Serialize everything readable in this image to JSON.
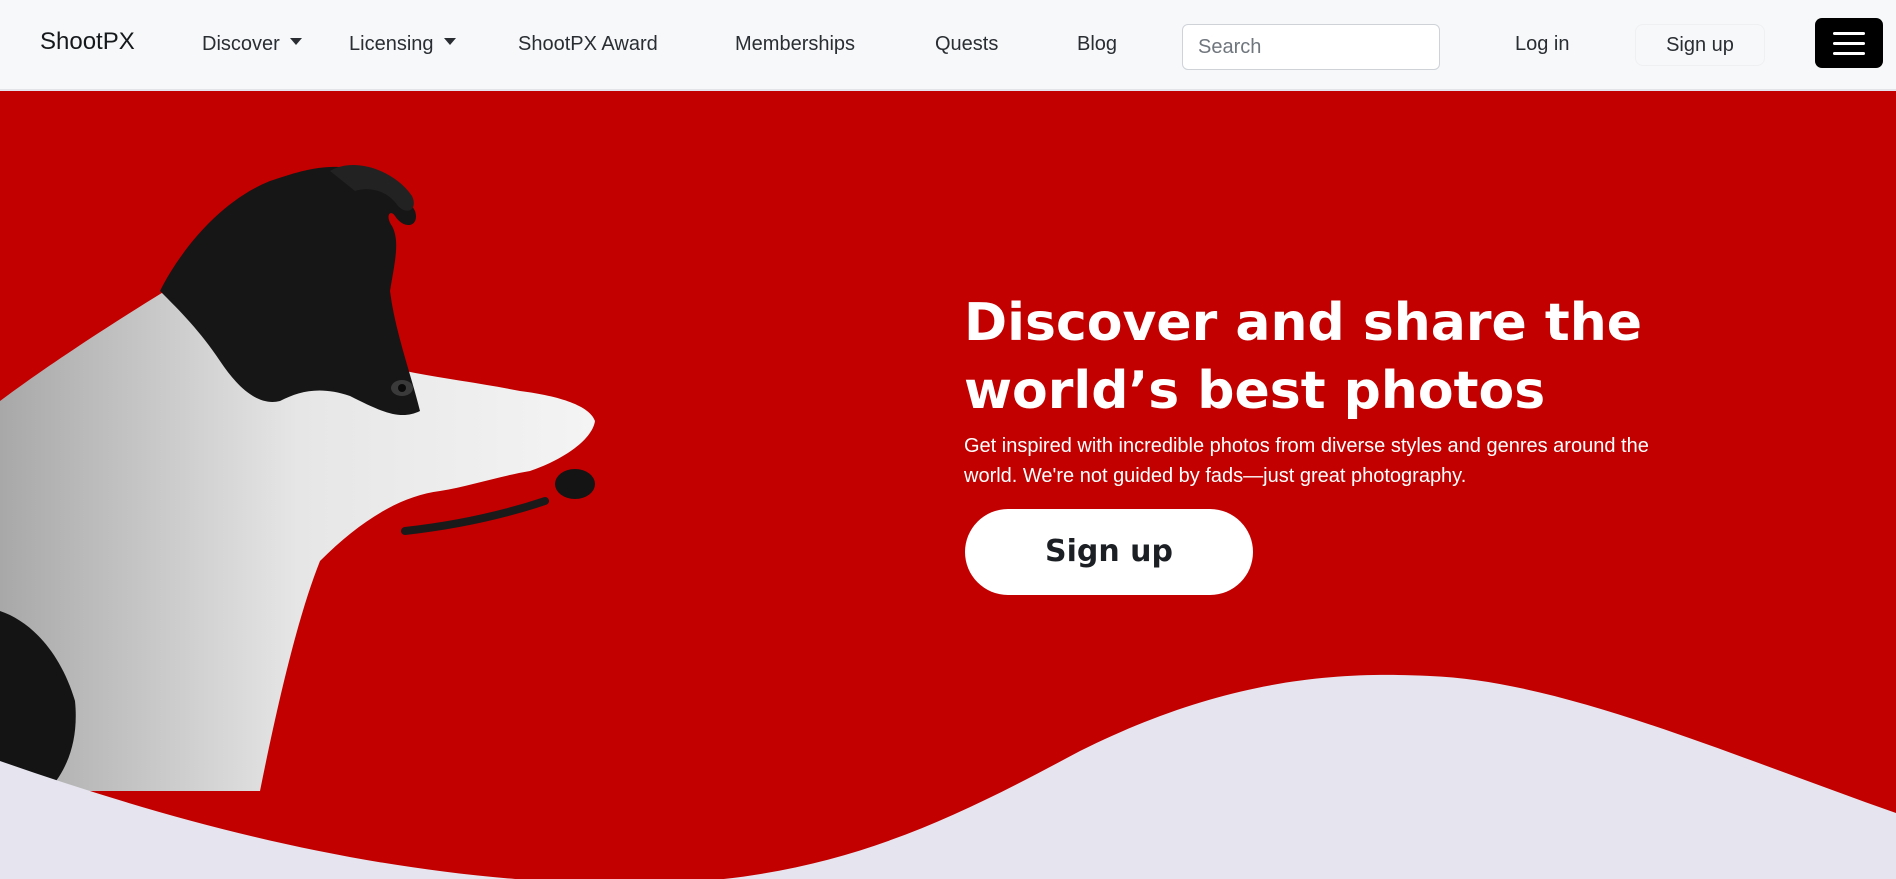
{
  "nav": {
    "brand": "ShootPX",
    "discover": "Discover",
    "licensing": "Licensing",
    "award": "ShootPX Award",
    "memberships": "Memberships",
    "quests": "Quests",
    "blog": "Blog",
    "search_placeholder": "Search",
    "login": "Log in",
    "signup": "Sign up",
    "menu_icon": "hamburger-icon"
  },
  "hero": {
    "title": "Discover and share the world’s best photos",
    "subtitle": "Get inspired with incredible photos from diverse styles and genres around the world. We're not guided by fads—just great photography.",
    "cta": "Sign up",
    "image": "border-collie-dog-profile"
  },
  "colors": {
    "hero_bg": "#c20000",
    "wave": "#e6e4ee",
    "nav_bg": "#f7f8f9",
    "toggler_bg": "#000000"
  }
}
